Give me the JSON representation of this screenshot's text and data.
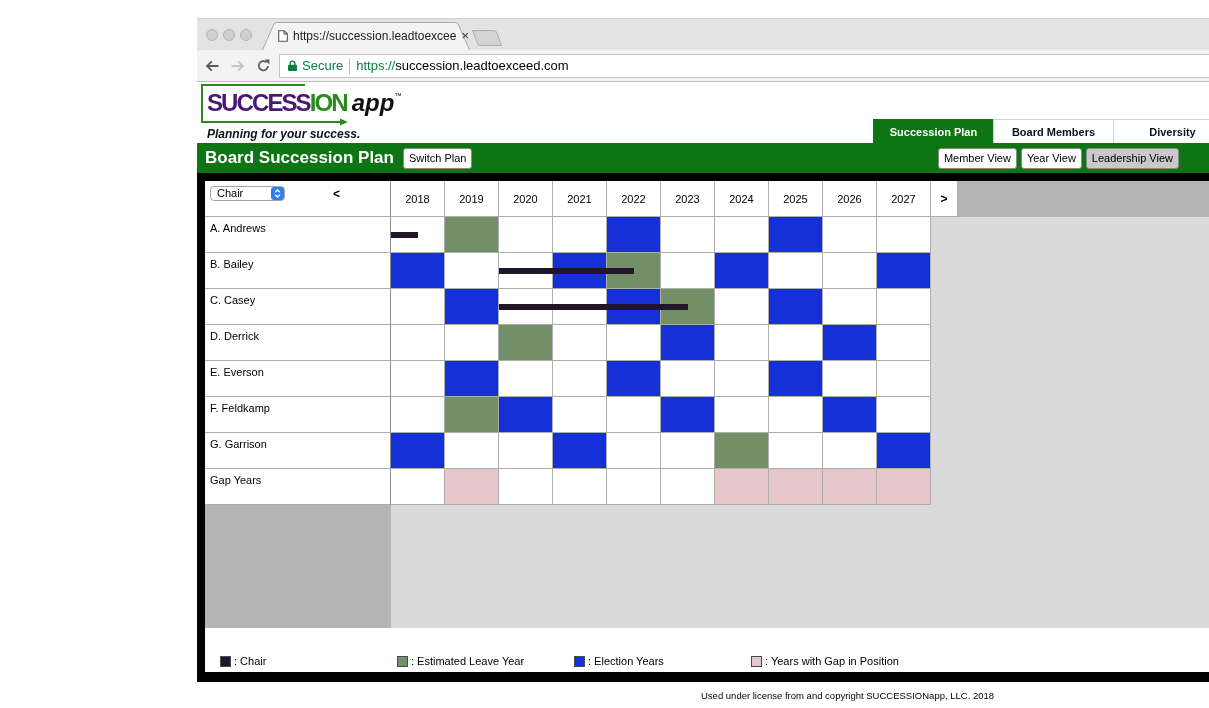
{
  "browser": {
    "nav_buttons": [
      {
        "kind": "back",
        "disabled": false
      },
      {
        "kind": "forward",
        "disabled": true
      },
      {
        "kind": "reload",
        "disabled": false
      }
    ],
    "tab_title": "https://succession.leadtoexcee",
    "tab_close": "×",
    "secure_label": "Secure",
    "url_scheme": "https://",
    "url_rest": "succession.leadtoexceed.com"
  },
  "logo": {
    "word_1": "SUCCESS",
    "word_2": "ION",
    "suffix": "app",
    "trademark": "™"
  },
  "tagline": "Planning for your success.",
  "nav_tabs": [
    {
      "label": "Succession Plan",
      "selected": true
    },
    {
      "label": "Board Members",
      "selected": false
    },
    {
      "label": "Diversity",
      "selected": false
    }
  ],
  "plan_bar": {
    "title": "Board Succession Plan",
    "switch_button": "Switch Plan",
    "views": [
      {
        "label": "Member View",
        "selected": false
      },
      {
        "label": "Year View",
        "selected": false
      },
      {
        "label": "Leadership View",
        "selected": true
      }
    ]
  },
  "grid": {
    "position_select": "Chair",
    "prev_button": "<",
    "next_button": ">",
    "years": [
      "2018",
      "2019",
      "2020",
      "2021",
      "2022",
      "2023",
      "2024",
      "2025",
      "2026",
      "2027"
    ],
    "rows": [
      {
        "name": "A. Andrews",
        "cells": [
          {
            "kind": "none",
            "chair": true
          },
          {
            "kind": "leave",
            "chair": false
          },
          {
            "kind": "none",
            "chair": false
          },
          {
            "kind": "none",
            "chair": false
          },
          {
            "kind": "election",
            "chair": false
          },
          {
            "kind": "none",
            "chair": false
          },
          {
            "kind": "none",
            "chair": false
          },
          {
            "kind": "election",
            "chair": false
          },
          {
            "kind": "none",
            "chair": false
          },
          {
            "kind": "none",
            "chair": false
          }
        ]
      },
      {
        "name": "B. Bailey",
        "cells": [
          {
            "kind": "election",
            "chair": false
          },
          {
            "kind": "none",
            "chair": false
          },
          {
            "kind": "none",
            "chair": true
          },
          {
            "kind": "election",
            "chair": true
          },
          {
            "kind": "leave",
            "chair": true
          },
          {
            "kind": "none",
            "chair": false
          },
          {
            "kind": "election",
            "chair": false
          },
          {
            "kind": "none",
            "chair": false
          },
          {
            "kind": "none",
            "chair": false
          },
          {
            "kind": "election",
            "chair": false
          }
        ]
      },
      {
        "name": "C. Casey",
        "cells": [
          {
            "kind": "none",
            "chair": false
          },
          {
            "kind": "election",
            "chair": false
          },
          {
            "kind": "none",
            "chair": true
          },
          {
            "kind": "none",
            "chair": true
          },
          {
            "kind": "election",
            "chair": true
          },
          {
            "kind": "leave",
            "chair": true
          },
          {
            "kind": "none",
            "chair": false
          },
          {
            "kind": "election",
            "chair": false
          },
          {
            "kind": "none",
            "chair": false
          },
          {
            "kind": "none",
            "chair": false
          }
        ]
      },
      {
        "name": "D. Derrick",
        "cells": [
          {
            "kind": "none",
            "chair": false
          },
          {
            "kind": "none",
            "chair": false
          },
          {
            "kind": "leave",
            "chair": false
          },
          {
            "kind": "none",
            "chair": false
          },
          {
            "kind": "none",
            "chair": false
          },
          {
            "kind": "election",
            "chair": false
          },
          {
            "kind": "none",
            "chair": false
          },
          {
            "kind": "none",
            "chair": false
          },
          {
            "kind": "election",
            "chair": false
          },
          {
            "kind": "none",
            "chair": false
          }
        ]
      },
      {
        "name": "E. Everson",
        "cells": [
          {
            "kind": "none",
            "chair": false
          },
          {
            "kind": "election",
            "chair": false
          },
          {
            "kind": "none",
            "chair": false
          },
          {
            "kind": "none",
            "chair": false
          },
          {
            "kind": "election",
            "chair": false
          },
          {
            "kind": "none",
            "chair": false
          },
          {
            "kind": "none",
            "chair": false
          },
          {
            "kind": "election",
            "chair": false
          },
          {
            "kind": "none",
            "chair": false
          },
          {
            "kind": "none",
            "chair": false
          }
        ]
      },
      {
        "name": "F. Feldkamp",
        "cells": [
          {
            "kind": "none",
            "chair": false
          },
          {
            "kind": "leave",
            "chair": false
          },
          {
            "kind": "election",
            "chair": false
          },
          {
            "kind": "none",
            "chair": false
          },
          {
            "kind": "none",
            "chair": false
          },
          {
            "kind": "election",
            "chair": false
          },
          {
            "kind": "none",
            "chair": false
          },
          {
            "kind": "none",
            "chair": false
          },
          {
            "kind": "election",
            "chair": false
          },
          {
            "kind": "none",
            "chair": false
          }
        ]
      },
      {
        "name": "G. Garrison",
        "cells": [
          {
            "kind": "election",
            "chair": false
          },
          {
            "kind": "none",
            "chair": false
          },
          {
            "kind": "none",
            "chair": false
          },
          {
            "kind": "election",
            "chair": false
          },
          {
            "kind": "none",
            "chair": false
          },
          {
            "kind": "none",
            "chair": false
          },
          {
            "kind": "leave",
            "chair": false
          },
          {
            "kind": "none",
            "chair": false
          },
          {
            "kind": "none",
            "chair": false
          },
          {
            "kind": "election",
            "chair": false
          }
        ]
      },
      {
        "name": "Gap Years",
        "cells": [
          {
            "kind": "none",
            "chair": false
          },
          {
            "kind": "gap",
            "chair": false
          },
          {
            "kind": "none",
            "chair": false
          },
          {
            "kind": "none",
            "chair": false
          },
          {
            "kind": "none",
            "chair": false
          },
          {
            "kind": "none",
            "chair": false
          },
          {
            "kind": "gap",
            "chair": false
          },
          {
            "kind": "gap",
            "chair": false
          },
          {
            "kind": "gap",
            "chair": false
          },
          {
            "kind": "gap",
            "chair": false
          }
        ]
      }
    ]
  },
  "legend": [
    {
      "kind": "chair",
      "color": "#21152a",
      "label": ": Chair"
    },
    {
      "kind": "leave",
      "color": "#738f67",
      "label": ": Estimated Leave Year"
    },
    {
      "kind": "election",
      "color": "#1430d6",
      "label": ": Election Years"
    },
    {
      "kind": "gap",
      "color": "#e6c6c9",
      "label": ": Years with Gap in Position"
    }
  ],
  "footer": "Used under license from and copyright SUCCESSIONapp, LLC. 2018"
}
